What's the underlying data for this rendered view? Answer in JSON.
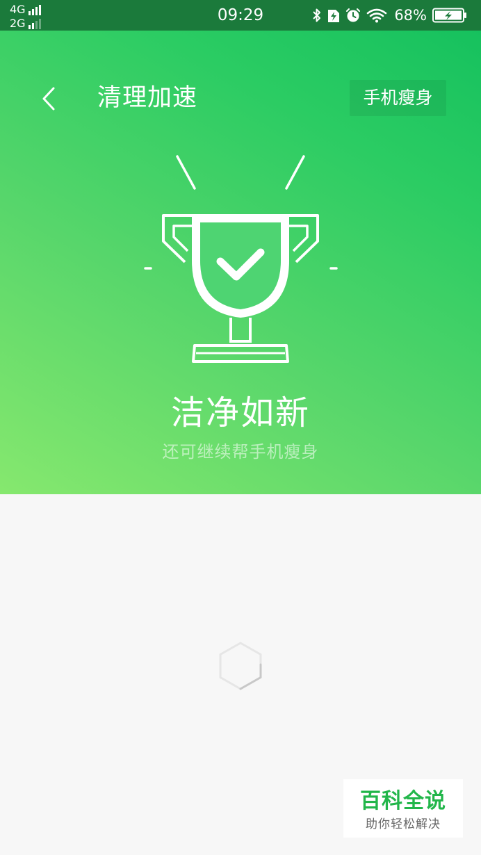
{
  "status_bar": {
    "network_1": "4G",
    "network_2": "2G",
    "time": "09:29",
    "battery": "68%",
    "icons": [
      "bluetooth-icon",
      "sim-charge-icon",
      "alarm-icon",
      "wifi-icon",
      "battery-charging-icon"
    ]
  },
  "header": {
    "back_icon": "chevron-left-icon",
    "title": "清理加速",
    "action_label": "手机瘦身"
  },
  "result": {
    "icon": "trophy-check-icon",
    "title": "洁净如新",
    "subtitle": "还可继续帮手机瘦身"
  },
  "loading": {
    "icon": "hexagon-spinner-icon"
  },
  "watermark": {
    "title": "百科全说",
    "subtitle": "助你轻松解决"
  },
  "colors": {
    "status_bar": "#1b7a3b",
    "gradient_start": "#86e86e",
    "gradient_end": "#16c15e",
    "background": "#f7f7f7",
    "watermark_green": "#22b64a"
  }
}
